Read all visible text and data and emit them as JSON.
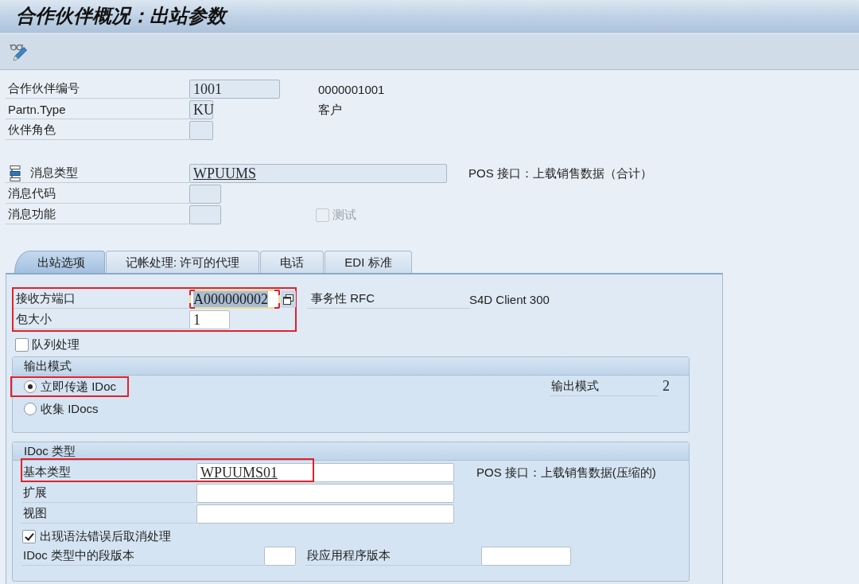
{
  "window": {
    "title": "合作伙伴概况：出站参数"
  },
  "header": {
    "partner_number": {
      "label": "合作伙伴编号",
      "value": "1001",
      "description": "0000001001"
    },
    "partner_type": {
      "label": "Partn.Type",
      "value": "KU",
      "description": "客户"
    },
    "partner_role": {
      "label": "伙伴角色"
    },
    "message_type": {
      "label": "消息类型",
      "value": "WPUUMS",
      "description": "POS 接口：上载销售数据（合计）"
    },
    "message_code": {
      "label": "消息代码"
    },
    "message_function": {
      "label": "消息功能"
    },
    "test": {
      "label": "测试",
      "checked": false,
      "disabled": true
    }
  },
  "tabs": [
    {
      "label": "出站选项",
      "selected": true
    },
    {
      "label": "记帐处理: 许可的代理",
      "selected": false
    },
    {
      "label": "电话",
      "selected": false
    },
    {
      "label": "EDI 标准",
      "selected": false
    }
  ],
  "outbound_options": {
    "port_settings": {
      "highlighted": true,
      "receiver_port": {
        "label": "接收方端口",
        "value": "A000000002",
        "focused": true
      },
      "pack_size": {
        "label": "包大小",
        "value": "1"
      }
    },
    "port_type": {
      "name": "事务性 RFC",
      "description": "S4D Client 300"
    },
    "queue_processing": {
      "label": "队列处理",
      "checked": false
    },
    "output_mode": {
      "title": "输出模式",
      "options": [
        {
          "label": "立即传递 IDoc",
          "selected": true,
          "highlighted": true
        },
        {
          "label": "收集 IDocs",
          "selected": false,
          "highlighted": false
        }
      ],
      "mode": {
        "label": "输出模式",
        "value": "2"
      }
    },
    "idoc_type": {
      "title": "IDoc 类型",
      "basic_type": {
        "label": "基本类型",
        "value": "WPUUMS01",
        "description": "POS 接口：上载销售数据(压缩的)",
        "highlighted": true
      },
      "extension": {
        "label": "扩展"
      },
      "view": {
        "label": "视图"
      },
      "cancel_on_syntax_error": {
        "label": "出现语法错误后取消处理",
        "checked": true
      },
      "segment_release": {
        "label": "IDoc 类型中的段版本"
      },
      "segment_application_release": {
        "label": "段应用程序版本"
      }
    }
  }
}
